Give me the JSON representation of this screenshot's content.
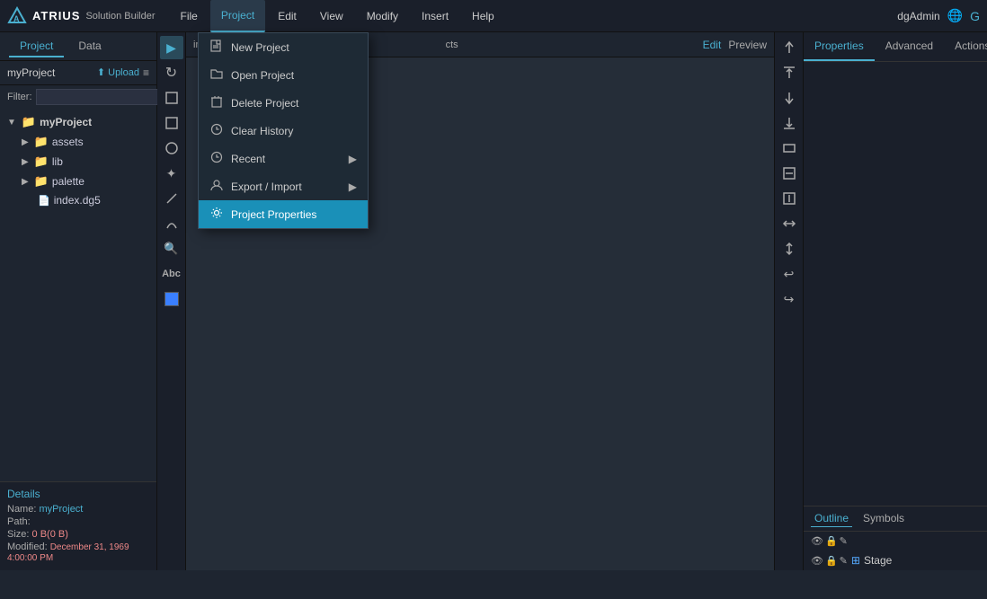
{
  "app": {
    "logo": "A",
    "brand": "ATRIUS",
    "subtitle": "Solution Builder"
  },
  "menubar": {
    "items": [
      "File",
      "Project",
      "Edit",
      "View",
      "Modify",
      "Insert",
      "Help"
    ],
    "active_index": 1
  },
  "subtabs": {
    "items": [
      "Project",
      "Data"
    ],
    "active_index": 0
  },
  "left_panel": {
    "project_name": "myProject",
    "upload_label": "Upload",
    "filter_label": "Filter:",
    "filter_placeholder": "",
    "tree": [
      {
        "label": "myProject",
        "level": 0,
        "type": "root",
        "expanded": true
      },
      {
        "label": "assets",
        "level": 1,
        "type": "folder"
      },
      {
        "label": "lib",
        "level": 1,
        "type": "folder"
      },
      {
        "label": "palette",
        "level": 1,
        "type": "folder"
      },
      {
        "label": "index.dg5",
        "level": 1,
        "type": "file"
      }
    ],
    "details": {
      "title": "Details",
      "name_label": "Name:",
      "name_value": "myProject",
      "path_label": "Path:",
      "path_value": "",
      "size_label": "Size:",
      "size_value": "0 B(0 B)",
      "modified_label": "Modified:",
      "modified_value": "December 31, 1969 4:00:00 PM"
    }
  },
  "tools": [
    {
      "name": "pointer-tool",
      "icon": "▶",
      "active": true
    },
    {
      "name": "rotate-tool",
      "icon": "↻",
      "active": false
    },
    {
      "name": "crop-tool",
      "icon": "⊡",
      "active": false
    },
    {
      "name": "rect-tool",
      "icon": "□",
      "active": false
    },
    {
      "name": "ellipse-tool",
      "icon": "○",
      "active": false
    },
    {
      "name": "puzzle-tool",
      "icon": "✦",
      "active": false
    },
    {
      "name": "line-tool",
      "icon": "╱",
      "active": false
    },
    {
      "name": "curve-tool",
      "icon": "⌒",
      "active": false
    },
    {
      "name": "search-tool",
      "icon": "🔍",
      "active": false
    },
    {
      "name": "text-tool",
      "icon": "Abc",
      "active": false
    },
    {
      "name": "color-tool",
      "icon": "■",
      "active": false,
      "color": "#3a7fff"
    }
  ],
  "canvas": {
    "breadcrumb": "in",
    "objects_label": "cts",
    "edit_label": "Edit",
    "preview_label": "Preview"
  },
  "right_toolbar": [
    {
      "name": "align-top",
      "icon": "⬆"
    },
    {
      "name": "align-top-stretch",
      "icon": "⇧"
    },
    {
      "name": "align-down",
      "icon": "⬇"
    },
    {
      "name": "align-down-stretch",
      "icon": "⇩"
    },
    {
      "name": "align-left-stretch",
      "icon": "⊠"
    },
    {
      "name": "resize-h",
      "icon": "⇔"
    },
    {
      "name": "resize-v",
      "icon": "⇕"
    },
    {
      "name": "fit-h",
      "icon": "↔"
    },
    {
      "name": "fit-v",
      "icon": "↕"
    },
    {
      "name": "undo",
      "icon": "↩"
    },
    {
      "name": "redo",
      "icon": "↪"
    }
  ],
  "right_panel": {
    "tabs": [
      "Properties",
      "Advanced",
      "Actions"
    ],
    "active_tab": 0,
    "outline_tabs": [
      "Outline",
      "Symbols"
    ],
    "active_outline_tab": 0,
    "stage_label": "Stage"
  },
  "dropdown_menu": {
    "items": [
      {
        "label": "New Project",
        "icon": "📄",
        "has_arrow": false,
        "highlighted": false
      },
      {
        "label": "Open Project",
        "icon": "📂",
        "has_arrow": false,
        "highlighted": false
      },
      {
        "label": "Delete Project",
        "icon": "🗑",
        "has_arrow": false,
        "highlighted": false
      },
      {
        "label": "Clear History",
        "icon": "🕐",
        "has_arrow": false,
        "highlighted": false
      },
      {
        "label": "Recent",
        "icon": "🕐",
        "has_arrow": true,
        "highlighted": false
      },
      {
        "label": "Export / Import",
        "icon": "👤",
        "has_arrow": true,
        "highlighted": false
      },
      {
        "label": "Project Properties",
        "icon": "⚙",
        "has_arrow": false,
        "highlighted": true
      }
    ]
  },
  "user": {
    "name": "dgAdmin"
  }
}
